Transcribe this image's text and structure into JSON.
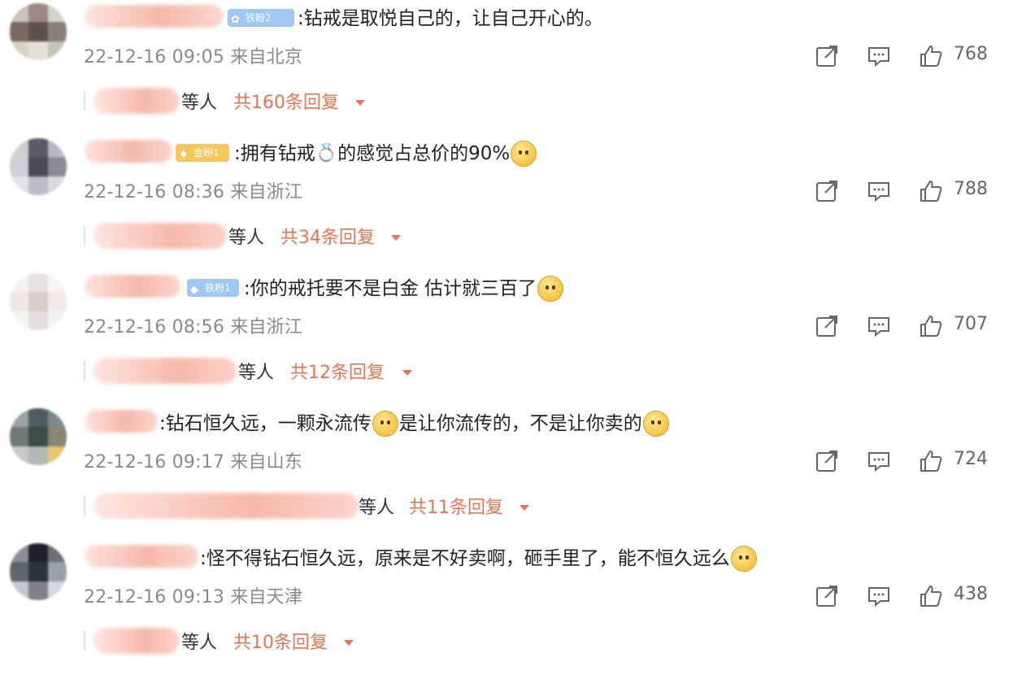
{
  "comments": [
    {
      "text": ":钻戒是取悦自己的，让自己开心的。",
      "badge": "铁粉2",
      "time": "22-12-16 09:05",
      "location": "来自北京",
      "likes": "768",
      "reply_suffix": "等人",
      "reply_count": "共160条回复"
    },
    {
      "text_a": ":拥有钻戒",
      "text_b": "的感觉占总价的90%",
      "ring": "💍",
      "badge": "金粉1",
      "time": "22-12-16 08:36",
      "location": "来自浙江",
      "likes": "788",
      "reply_suffix": "等人",
      "reply_count": "共34条回复"
    },
    {
      "text": ":你的戒托要不是白金 估计就三百了",
      "badge": "铁粉1",
      "time": "22-12-16 08:56",
      "location": "来自浙江",
      "likes": "707",
      "reply_suffix": "等人",
      "reply_count": "共12条回复"
    },
    {
      "text_a": ":钻石恒久远，一颗永流传",
      "text_b": "是让你流传的，不是让你卖的",
      "time": "22-12-16 09:17",
      "location": "来自山东",
      "likes": "724",
      "reply_suffix": "等人",
      "reply_count": "共11条回复"
    },
    {
      "text": ":怪不得钻石恒久远，原来是不好卖啊，砸手里了，能不恒久远么",
      "time": "22-12-16 09:13",
      "location": "来自天津",
      "likes": "438",
      "reply_suffix": "等人",
      "reply_count": "共10条回复"
    }
  ],
  "colors": {
    "accent": "#eb7350",
    "meta": "#8a8a8a",
    "badge_iron": "#9fc7f2",
    "badge_gold": "#f6c75a"
  },
  "icons": [
    "share-icon",
    "comment-icon",
    "like-icon",
    "caret-down-icon",
    "emoji-icon"
  ]
}
